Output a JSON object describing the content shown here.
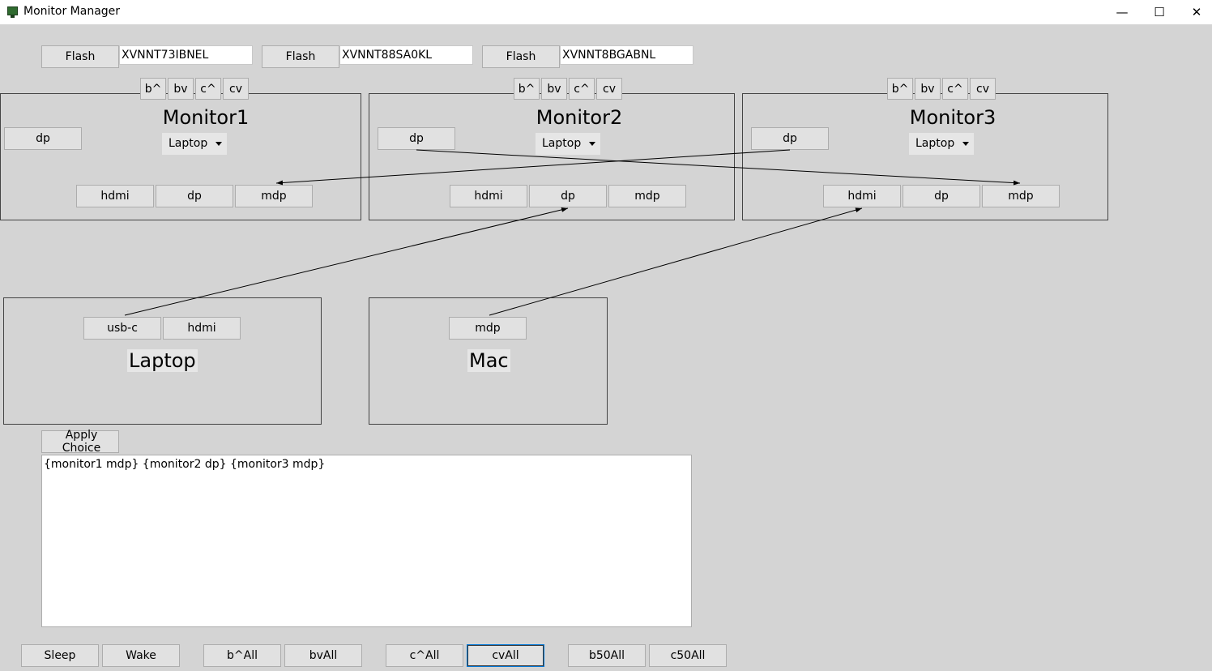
{
  "window": {
    "title": "Monitor Manager",
    "minimize": "—",
    "maximize": "☐",
    "close": "✕"
  },
  "flash": [
    {
      "label": "Flash",
      "serial": "XVNNT73IBNEL"
    },
    {
      "label": "Flash",
      "serial": "XVNNT88SA0KL"
    },
    {
      "label": "Flash",
      "serial": "XVNNT8BGABNL"
    }
  ],
  "monitors": [
    {
      "name": "Monitor1",
      "source": "Laptop",
      "controls": [
        "b^",
        "bv",
        "c^",
        "cv"
      ],
      "input_button": "dp",
      "ports": [
        "hdmi",
        "dp",
        "mdp"
      ]
    },
    {
      "name": "Monitor2",
      "source": "Laptop",
      "controls": [
        "b^",
        "bv",
        "c^",
        "cv"
      ],
      "input_button": "dp",
      "ports": [
        "hdmi",
        "dp",
        "mdp"
      ]
    },
    {
      "name": "Monitor3",
      "source": "Laptop",
      "controls": [
        "b^",
        "bv",
        "c^",
        "cv"
      ],
      "input_button": "dp",
      "ports": [
        "hdmi",
        "dp",
        "mdp"
      ]
    }
  ],
  "computers": [
    {
      "name": "Laptop",
      "ports": [
        "usb-c",
        "hdmi"
      ]
    },
    {
      "name": "Mac",
      "ports": [
        "mdp"
      ]
    }
  ],
  "apply": {
    "label": "Apply Choice",
    "text": "{monitor1 mdp} {monitor2 dp} {monitor3 mdp}"
  },
  "bottom": [
    "Sleep",
    "Wake",
    "b^All",
    "bvAll",
    "c^All",
    "cvAll",
    "b50All",
    "c50All"
  ]
}
